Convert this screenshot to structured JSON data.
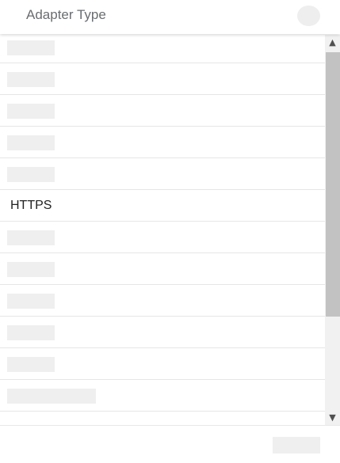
{
  "header": {
    "title": "Adapter Type"
  },
  "list": {
    "items": [
      {
        "label": ""
      },
      {
        "label": ""
      },
      {
        "label": ""
      },
      {
        "label": ""
      },
      {
        "label": ""
      },
      {
        "label": "HTTPS"
      },
      {
        "label": ""
      },
      {
        "label": ""
      },
      {
        "label": ""
      },
      {
        "label": ""
      },
      {
        "label": ""
      },
      {
        "label": ""
      }
    ]
  },
  "scrollbar": {
    "up_icon": "chevron-up-icon",
    "down_icon": "chevron-down-icon"
  },
  "footer": {
    "button_label": ""
  }
}
